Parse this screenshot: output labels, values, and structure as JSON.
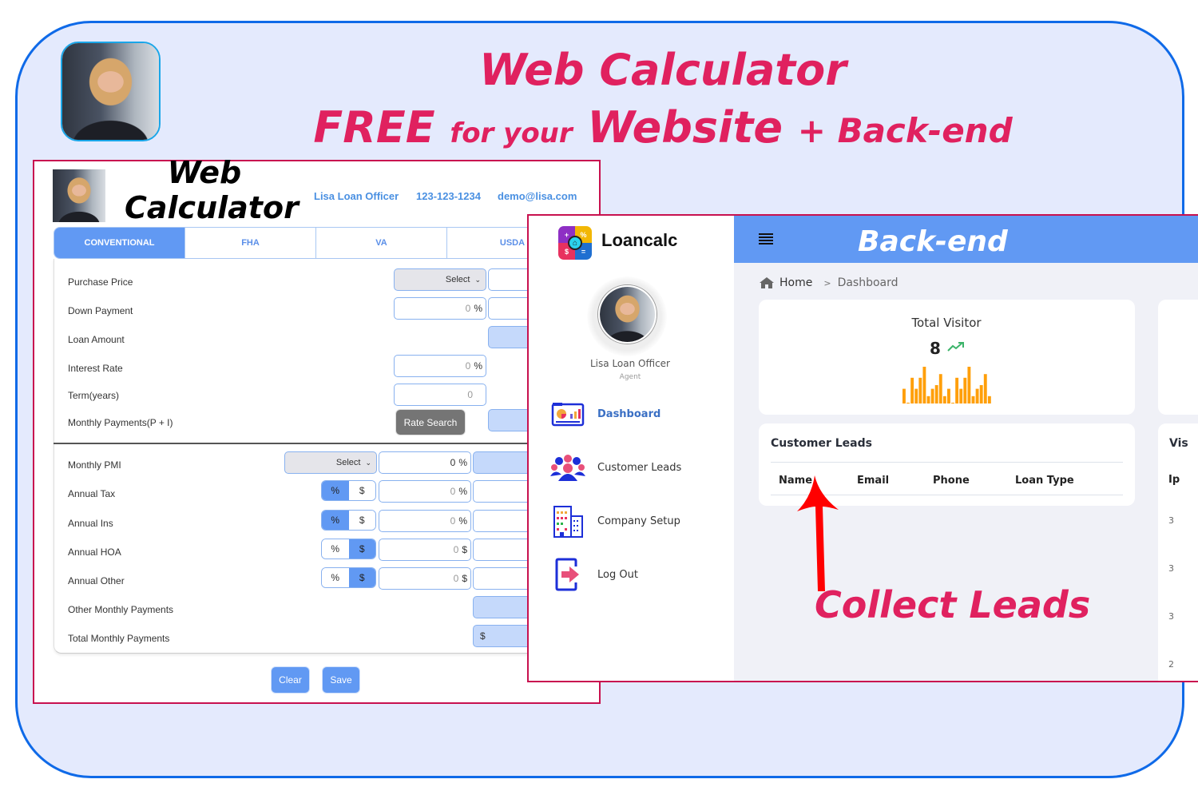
{
  "headline": {
    "line1": "Web Calculator",
    "free": "FREE",
    "for_your": "for your",
    "website": "Website",
    "plus_backend": "+ Back-end"
  },
  "calculator": {
    "title_line1": "Web",
    "title_line2": "Calculator",
    "contact": {
      "name": "Lisa Loan Officer",
      "phone": "123-123-1234",
      "email": "demo@lisa.com"
    },
    "tabs": [
      {
        "label": "CONVENTIONAL",
        "active": true
      },
      {
        "label": "FHA",
        "active": false
      },
      {
        "label": "VA",
        "active": false
      },
      {
        "label": "USDA",
        "active": false
      }
    ],
    "rows": {
      "purchase_price": {
        "label": "Purchase Price",
        "select": "Select"
      },
      "down_payment": {
        "label": "Down Payment",
        "value": "0",
        "unit": "%"
      },
      "loan_amount": {
        "label": "Loan Amount"
      },
      "interest_rate": {
        "label": "Interest Rate",
        "value": "0",
        "unit": "%"
      },
      "term": {
        "label": "Term(years)",
        "value": "0"
      },
      "monthly_pi": {
        "label": "Monthly Payments(P + I)",
        "button": "Rate Search"
      },
      "monthly_pmi": {
        "label": "Monthly PMI",
        "select": "Select",
        "value": "0",
        "unit": "%"
      },
      "annual_tax": {
        "label": "Annual Tax",
        "toggle": [
          "%",
          "$"
        ],
        "selected": "%",
        "value": "0",
        "unit": "%"
      },
      "annual_ins": {
        "label": "Annual Ins",
        "toggle": [
          "%",
          "$"
        ],
        "selected": "%",
        "value": "0",
        "unit": "%"
      },
      "annual_hoa": {
        "label": "Annual HOA",
        "toggle": [
          "%",
          "$"
        ],
        "selected": "$",
        "value": "0",
        "unit": "$"
      },
      "annual_other": {
        "label": "Annual Other",
        "toggle": [
          "%",
          "$"
        ],
        "selected": "$",
        "value": "0",
        "unit": "$"
      },
      "other_monthly": {
        "label": "Other Monthly Payments"
      },
      "total_monthly": {
        "label": "Total Monthly Payments",
        "prefix": "$"
      }
    },
    "buttons": {
      "clear": "Clear",
      "save": "Save"
    }
  },
  "backend": {
    "brand": "Loancalc",
    "logo_symbols": [
      "+",
      "%",
      "$",
      "="
    ],
    "header_title": "Back-end",
    "user": {
      "name": "Lisa Loan Officer",
      "role": "Agent"
    },
    "nav": [
      {
        "label": "Dashboard",
        "icon": "dashboard-icon",
        "active": true
      },
      {
        "label": "Customer Leads",
        "icon": "customers-icon",
        "active": false
      },
      {
        "label": "Company Setup",
        "icon": "building-icon",
        "active": false
      },
      {
        "label": "Log Out",
        "icon": "logout-icon",
        "active": false
      }
    ],
    "breadcrumb": {
      "home": "Home",
      "separator": ">",
      "current": "Dashboard"
    },
    "total_visitor": {
      "title": "Total Visitor",
      "count": "8",
      "trend": "up",
      "spark_color": "#ff9f0a",
      "spark_values": [
        4,
        0.2,
        7,
        4,
        7,
        10,
        2,
        4,
        5,
        8,
        2,
        4,
        0.2,
        7,
        4,
        7,
        10,
        2,
        4,
        5,
        8,
        2
      ]
    },
    "customer_leads": {
      "title": "Customer Leads",
      "columns": [
        "Name",
        "Email",
        "Phone",
        "Loan Type"
      ]
    },
    "visitors_partial": {
      "title": "Vis",
      "column": "Ip",
      "cells": [
        "3",
        "3",
        "3",
        "2"
      ]
    }
  },
  "annotation": {
    "text": "Collect Leads",
    "color": "#e0215f",
    "arrow_color": "#ff0000"
  },
  "colors": {
    "accent": "#6199f3",
    "brand_pink": "#e0215f",
    "frame": "#0f6ae8",
    "panel_border": "#c8114f"
  }
}
